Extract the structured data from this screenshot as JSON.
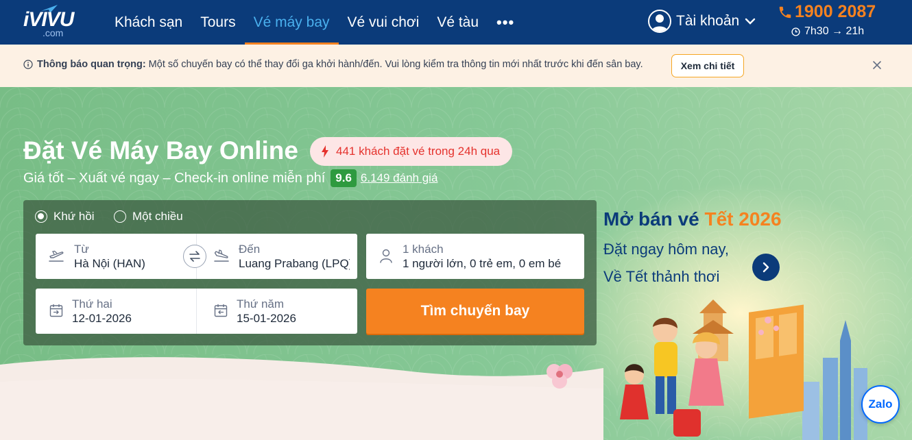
{
  "header": {
    "logo": {
      "main": "iVIVU",
      "sub": ".com"
    },
    "nav": [
      {
        "label": "Khách sạn",
        "active": false
      },
      {
        "label": "Tours",
        "active": false
      },
      {
        "label": "Vé máy bay",
        "active": true
      },
      {
        "label": "Vé vui chơi",
        "active": false
      },
      {
        "label": "Vé tàu",
        "active": false
      },
      {
        "label": "•••",
        "active": false
      }
    ],
    "account_label": "Tài khoản",
    "hotline": "1900 2087",
    "hours": "7h30 → 21h"
  },
  "notice": {
    "bold": "Thông báo quan trọng:",
    "text": "Một số chuyến bay có thể thay đổi ga khởi hành/đến. Vui lòng kiểm tra thông tin mới nhất trước khi đến sân bay.",
    "button": "Xem chi tiết"
  },
  "hero": {
    "title": "Đặt Vé Máy Bay Online",
    "badge": "441 khách đặt vé trong 24h qua",
    "subtitle": "Giá tốt – Xuất vé ngay – Check-in online miễn phí",
    "score": "9.6",
    "reviews": "6.149 đánh giá"
  },
  "search": {
    "trip_types": [
      {
        "label": "Khứ hồi",
        "selected": true
      },
      {
        "label": "Một chiều",
        "selected": false
      }
    ],
    "from": {
      "label": "Từ",
      "value": "Hà Nội (HAN)"
    },
    "to": {
      "label": "Đến",
      "value": "Luang Prabang (LPQ)"
    },
    "passengers": {
      "label": "1 khách",
      "value": "1 người lớn, 0 trẻ em, 0 em bé"
    },
    "depart": {
      "label": "Thứ hai",
      "value": "12-01-2026"
    },
    "return": {
      "label": "Thứ năm",
      "value": "15-01-2026"
    },
    "button": "Tìm chuyến bay"
  },
  "promo": {
    "title_prefix": "Mở bán vé",
    "title_accent": "Tết 2026",
    "line1": "Đặt ngay hôm nay,",
    "line2": "Về Tết thảnh thơi"
  },
  "zalo": "Zalo",
  "colors": {
    "header": "#0b3b7a",
    "accent": "#f58220",
    "nav_active": "#4ab0ee",
    "notice_bg": "#fdf1e4",
    "hero_green": "#7ac08a",
    "badge_red": "#e5322d"
  }
}
